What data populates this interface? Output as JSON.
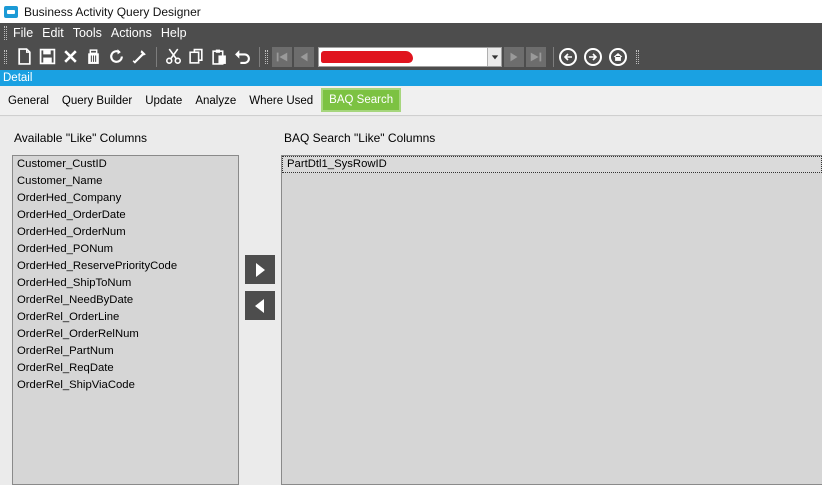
{
  "window": {
    "title": "Business Activity Query Designer"
  },
  "menu": {
    "items": [
      "File",
      "Edit",
      "Tools",
      "Actions",
      "Help"
    ]
  },
  "toolbar": {
    "icons": [
      "new-icon",
      "save-icon",
      "delete-icon",
      "clear-icon",
      "refresh-icon",
      "undo-all-icon",
      "cut-icon",
      "copy-icon",
      "paste-icon",
      "undo-icon"
    ],
    "record_combo": {
      "value": ""
    }
  },
  "detail_bar": {
    "label": "Detail"
  },
  "tabs": [
    {
      "label": "General"
    },
    {
      "label": "Query Builder"
    },
    {
      "label": "Update"
    },
    {
      "label": "Analyze"
    },
    {
      "label": "Where Used"
    },
    {
      "label": "BAQ Search"
    }
  ],
  "available_panel": {
    "label": "Available \"Like\" Columns",
    "items": [
      "Customer_CustID",
      "Customer_Name",
      "OrderHed_Company",
      "OrderHed_OrderDate",
      "OrderHed_OrderNum",
      "OrderHed_PONum",
      "OrderHed_ReservePriorityCode",
      "OrderHed_ShipToNum",
      "OrderRel_NeedByDate",
      "OrderRel_OrderLine",
      "OrderRel_OrderRelNum",
      "OrderRel_PartNum",
      "OrderRel_ReqDate",
      "OrderRel_ShipViaCode"
    ]
  },
  "search_panel": {
    "label": "BAQ Search \"Like\" Columns",
    "items": [
      "PartDtl1_SysRowID"
    ]
  },
  "colors": {
    "accent_blue": "#1aa1e2",
    "tab_active_green": "#7cc242",
    "toolbar_gray": "#4d4d4d"
  }
}
